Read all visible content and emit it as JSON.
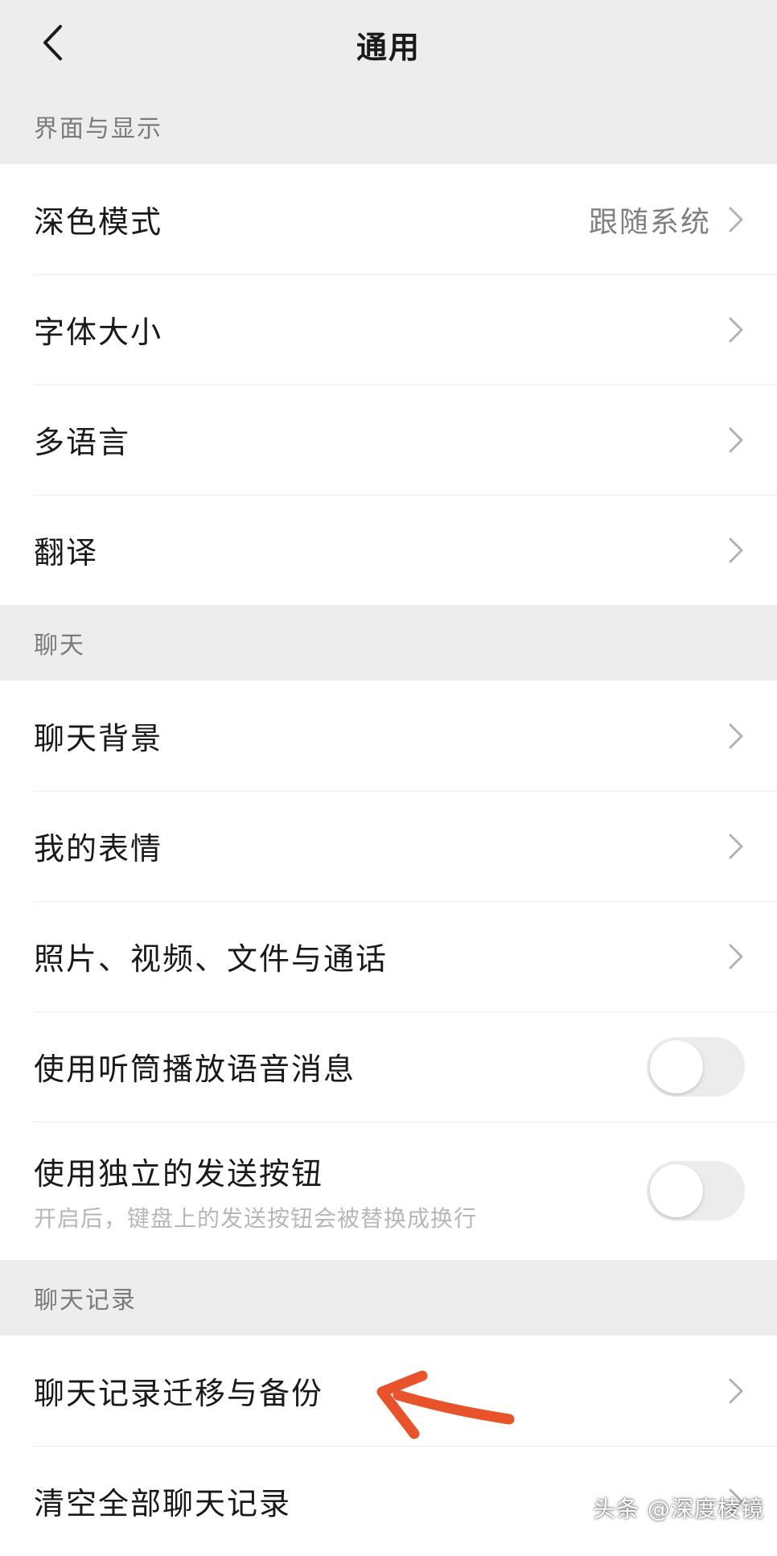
{
  "navbar": {
    "title": "通用",
    "back_icon": "chevron-left-icon"
  },
  "sections": {
    "display": {
      "header": "界面与显示",
      "dark_mode": {
        "label": "深色模式",
        "value": "跟随系统"
      },
      "font_size": {
        "label": "字体大小"
      },
      "language": {
        "label": "多语言"
      },
      "translate": {
        "label": "翻译"
      }
    },
    "chat": {
      "header": "聊天",
      "chat_background": {
        "label": "聊天背景"
      },
      "my_stickers": {
        "label": "我的表情"
      },
      "media_files": {
        "label": "照片、视频、文件与通话"
      },
      "earpiece": {
        "label": "使用听筒播放语音消息",
        "toggle_on": false
      },
      "send_button": {
        "label": "使用独立的发送按钮",
        "subtitle": "开启后，键盘上的发送按钮会被替换成换行",
        "toggle_on": false
      }
    },
    "history": {
      "header": "聊天记录",
      "migrate_backup": {
        "label": "聊天记录迁移与备份"
      },
      "clear_all": {
        "label": "清空全部聊天记录"
      }
    }
  },
  "annotation": {
    "arrow_color": "#e8532b",
    "arrow_icon": "hand-drawn-arrow-icon"
  },
  "watermark": {
    "text": "头条 @深度棱镜"
  }
}
